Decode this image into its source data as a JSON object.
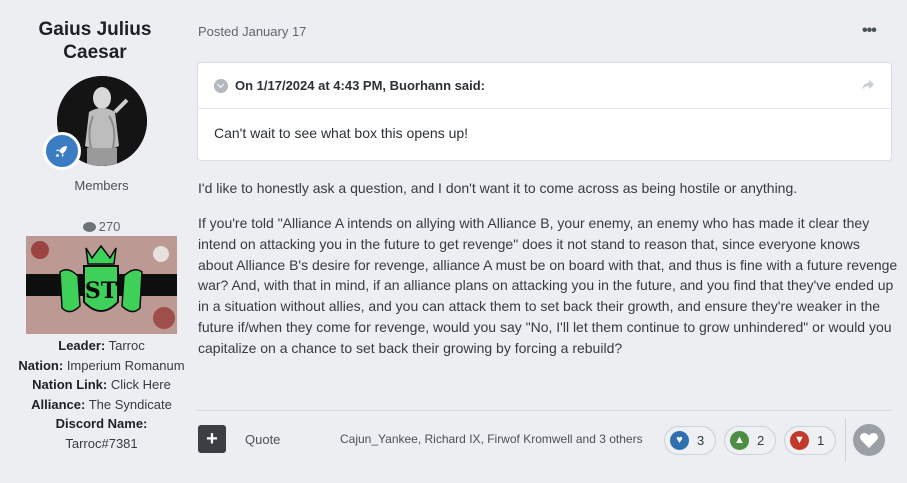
{
  "author": {
    "name": "Gaius Julius Caesar",
    "group": "Members",
    "post_count": "270",
    "badge_icon": "rocket-icon",
    "fields": [
      {
        "label": "Leader:",
        "value": "Tarroc"
      },
      {
        "label": "Nation:",
        "value": "Imperium Romanum"
      },
      {
        "label": "Nation Link:",
        "value": "Click Here"
      },
      {
        "label": "Alliance:",
        "value": "The Syndicate"
      },
      {
        "label": "Discord Name:",
        "value": "Tarroc#7381"
      }
    ],
    "banner_letters": "ST"
  },
  "post": {
    "date": "Posted January 17",
    "menu_icon": "ellipsis-icon",
    "quote": {
      "cite": "On 1/17/2024 at 4:43 PM, Buorhann said:",
      "body": "Can't wait to see what box this opens up!"
    },
    "paragraphs": [
      "I'd like to honestly ask a question, and I don't want it to come across as being hostile or anything.",
      "If you're told \"Alliance A intends on allying with Alliance B, your enemy, an enemy who has made it clear they intend on attacking you in the future to get revenge\" does it not stand to reason that, since everyone knows about Alliance B's desire for revenge, alliance A must be on board with that, and thus is fine with a future revenge war? And, with that in mind, if an alliance plans on attacking you in the future, and you find that they've ended up in a situation without allies, and you can attack them to set back their growth, and ensure they're weaker in the future if/when they come for revenge, would you say \"No, I'll let them continue to grow unhindered\" or would you capitalize on a chance to set back their growing by forcing a rebuild?"
    ]
  },
  "footer": {
    "plus_label": "+",
    "quote_label": "Quote",
    "reacted_by": "Cajun_Yankee, Richard IX, Firwof Kromwell and 3 others",
    "reactions": [
      {
        "icon": "heart-icon",
        "count": "3",
        "color": "#2f6fb0"
      },
      {
        "icon": "thumbs-up-icon",
        "count": "2",
        "color": "#4e8e44"
      },
      {
        "icon": "thumbs-down-icon",
        "count": "1",
        "color": "#c0392b"
      }
    ],
    "like_icon": "heart-icon"
  },
  "colors": {
    "background": "#eceef2",
    "badge": "#3a7dc2",
    "banner_green": "#3fd05a"
  }
}
